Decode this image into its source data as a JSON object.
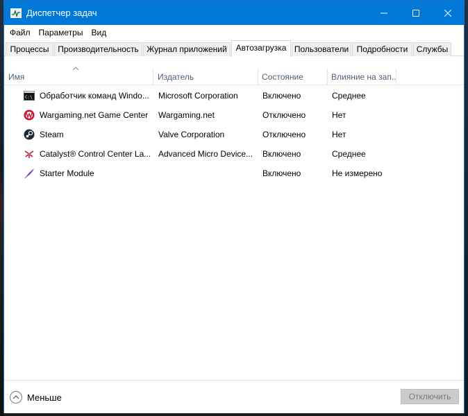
{
  "window": {
    "title": "Диспетчер задач",
    "accent": "#0078d7"
  },
  "menu": [
    "Файл",
    "Параметры",
    "Вид"
  ],
  "tabs": [
    {
      "label": "Процессы",
      "active": false
    },
    {
      "label": "Производительность",
      "active": false
    },
    {
      "label": "Журнал приложений",
      "active": false
    },
    {
      "label": "Автозагрузка",
      "active": true
    },
    {
      "label": "Пользователи",
      "active": false
    },
    {
      "label": "Подробности",
      "active": false
    },
    {
      "label": "Службы",
      "active": false
    }
  ],
  "columns": {
    "name": "Имя",
    "publisher": "Издатель",
    "status": "Состояние",
    "impact": "Влияние на зап..."
  },
  "rows": [
    {
      "icon": "cmd-icon",
      "name": "Обработчик команд Windo...",
      "publisher": "Microsoft Corporation",
      "status": "Включено",
      "impact": "Среднее"
    },
    {
      "icon": "wargaming-icon",
      "name": "Wargaming.net Game Center",
      "publisher": "Wargaming.net",
      "status": "Отключено",
      "impact": "Нет"
    },
    {
      "icon": "steam-icon",
      "name": "Steam",
      "publisher": "Valve Corporation",
      "status": "Отключено",
      "impact": "Нет"
    },
    {
      "icon": "catalyst-icon",
      "name": "Catalyst® Control Center La...",
      "publisher": "Advanced Micro Device...",
      "status": "Включено",
      "impact": "Среднее"
    },
    {
      "icon": "starter-feather-icon",
      "name": "Starter Module",
      "publisher": "",
      "status": "Включено",
      "impact": "Не измерено"
    }
  ],
  "footer": {
    "less_label": "Меньше",
    "disable_label": "Отключить"
  }
}
